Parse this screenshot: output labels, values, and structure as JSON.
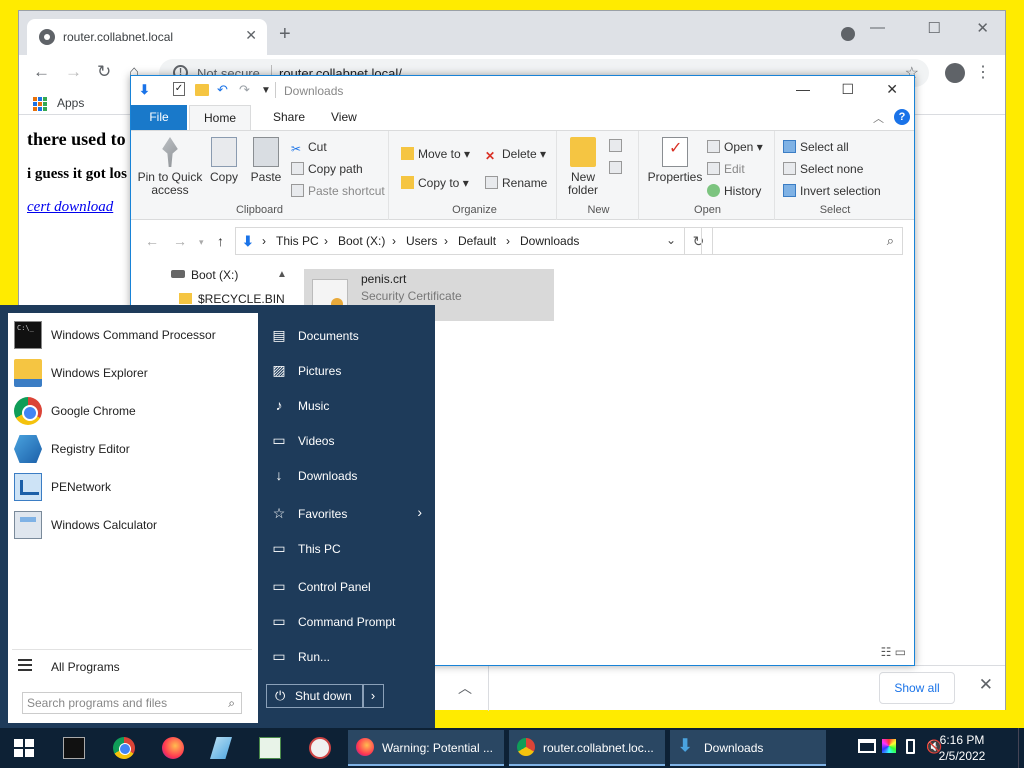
{
  "browser": {
    "tab_title": "router.collabnet.local",
    "tab_close": "✕",
    "new_tab": "+",
    "security": "Not secure",
    "url": "router.collabnet.local/",
    "bookmarks": {
      "apps": "Apps"
    },
    "page": {
      "heading": "there used to",
      "subheading": "i guess it got los",
      "link": "cert download"
    },
    "download_bar": {
      "show_all": "Show all"
    }
  },
  "explorer": {
    "window_title": "Downloads",
    "tabs": {
      "file": "File",
      "home": "Home",
      "share": "Share",
      "view": "View"
    },
    "ribbon": {
      "clipboard": {
        "label": "Clipboard",
        "pin": "Pin to Quick access",
        "copy": "Copy",
        "paste": "Paste",
        "cut": "Cut",
        "copy_path": "Copy path",
        "paste_shortcut": "Paste shortcut"
      },
      "organize": {
        "label": "Organize",
        "move_to": "Move to",
        "copy_to": "Copy to",
        "delete": "Delete",
        "rename": "Rename"
      },
      "new": {
        "label": "New",
        "new_folder": "New folder"
      },
      "open": {
        "label": "Open",
        "properties": "Properties",
        "open": "Open",
        "edit": "Edit",
        "history": "History"
      },
      "select": {
        "label": "Select",
        "select_all": "Select all",
        "select_none": "Select none",
        "invert": "Invert selection"
      }
    },
    "breadcrumb": [
      "This PC",
      "Boot (X:)",
      "Users",
      "Default",
      "Downloads"
    ],
    "nav": {
      "drive": "Boot (X:)",
      "recycle": "$RECYCLE.BIN"
    },
    "file": {
      "name": "penis.crt",
      "type": "Security Certificate"
    }
  },
  "start_menu": {
    "apps": [
      {
        "label": "Windows Command Processor",
        "icon": "cmd-icon"
      },
      {
        "label": "Windows Explorer",
        "icon": "explorer-icon"
      },
      {
        "label": "Google Chrome",
        "icon": "chrome-icon"
      },
      {
        "label": "Registry Editor",
        "icon": "registry-icon"
      },
      {
        "label": "PENetwork",
        "icon": "network-icon"
      },
      {
        "label": "Windows Calculator",
        "icon": "calculator-icon"
      }
    ],
    "all_programs": "All Programs",
    "search_placeholder": "Search programs and files",
    "places": [
      "Documents",
      "Pictures",
      "Music",
      "Videos",
      "Downloads",
      "Favorites",
      "This PC",
      "Control Panel",
      "Command Prompt",
      "Run..."
    ],
    "shutdown": "Shut down"
  },
  "taskbar": {
    "tasks": [
      {
        "label": "Warning: Potential ..."
      },
      {
        "label": "router.collabnet.loc..."
      },
      {
        "label": "Downloads"
      }
    ],
    "time": "6:16 PM",
    "date": "2/5/2022"
  }
}
